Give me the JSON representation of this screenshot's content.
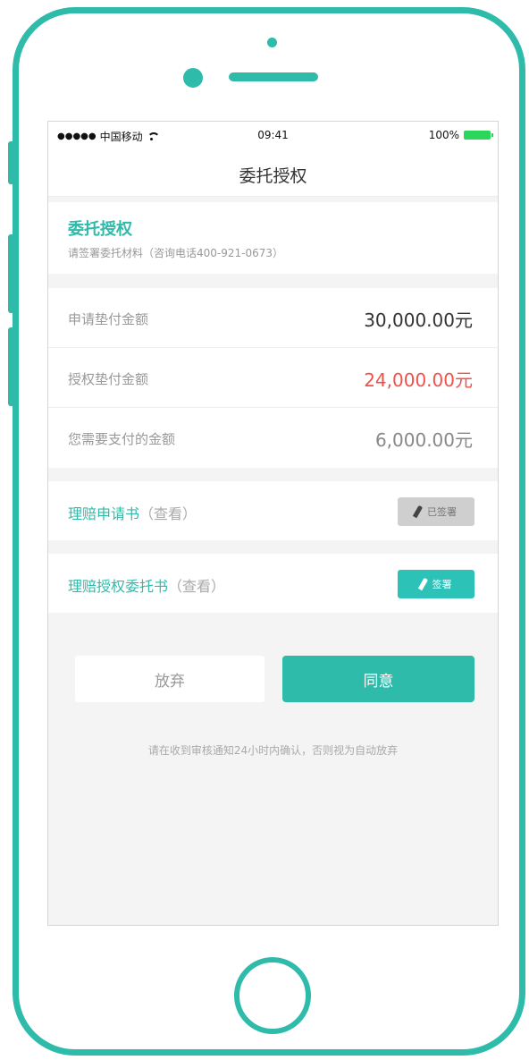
{
  "status_bar": {
    "signal": "●●●●●",
    "carrier": "中国移动",
    "time": "09:41",
    "battery": "100%"
  },
  "nav": {
    "title": "委托授权"
  },
  "auth_header": {
    "title": "委托授权",
    "subtitle": "请签署委托材料（咨询电话400-921-0673）"
  },
  "amounts": [
    {
      "label": "申请垫付金额",
      "value": "30,000.00元"
    },
    {
      "label": "授权垫付金额",
      "value": "24,000.00元"
    },
    {
      "label": "您需要支付的金额",
      "value": "6,000.00元"
    }
  ],
  "documents": [
    {
      "title": "理赔申请书",
      "view": "（查看）",
      "button": "已签署"
    },
    {
      "title": "理赔授权委托书",
      "view": "（查看）",
      "button": "签署"
    }
  ],
  "actions": {
    "abandon": "放弃",
    "agree": "同意"
  },
  "notice": "请在收到审核通知24小时内确认，否则视为自动放弃",
  "colors": {
    "accent": "#2ebbaa",
    "highlight_red": "#f0514b",
    "battery_green": "#2bd65a"
  }
}
